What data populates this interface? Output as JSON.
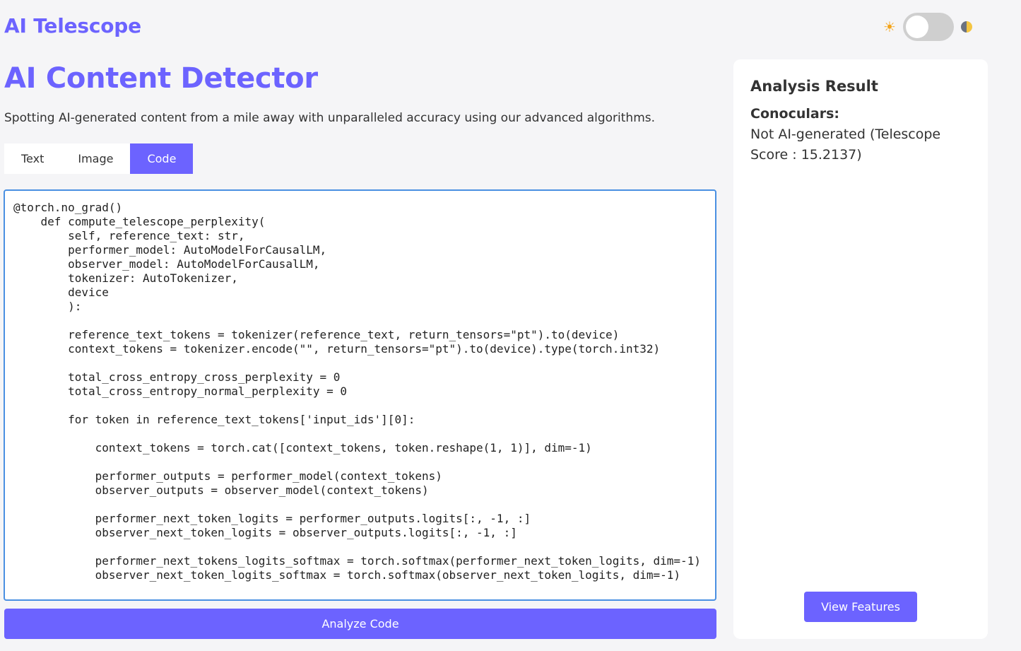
{
  "app": {
    "title": "AI Telescope"
  },
  "theme": {
    "sun_icon": "sun-icon",
    "moon_icon": "moon-icon",
    "sun_glyph": "☀"
  },
  "header": {
    "title": "AI Content Detector",
    "subtitle": "Spotting AI-generated content from a mile away with unparalleled accuracy using our advanced algorithms."
  },
  "tabs": [
    {
      "label": "Text",
      "active": false
    },
    {
      "label": "Image",
      "active": false
    },
    {
      "label": "Code",
      "active": true
    }
  ],
  "editor": {
    "code": "@torch.no_grad()\n    def compute_telescope_perplexity(\n        self, reference_text: str,\n        performer_model: AutoModelForCausalLM,\n        observer_model: AutoModelForCausalLM,\n        tokenizer: AutoTokenizer,\n        device\n        ):\n\n        reference_text_tokens = tokenizer(reference_text, return_tensors=\"pt\").to(device)\n        context_tokens = tokenizer.encode(\"\", return_tensors=\"pt\").to(device).type(torch.int32)\n\n        total_cross_entropy_cross_perplexity = 0\n        total_cross_entropy_normal_perplexity = 0\n\n        for token in reference_text_tokens['input_ids'][0]:\n\n            context_tokens = torch.cat([context_tokens, token.reshape(1, 1)], dim=-1)\n\n            performer_outputs = performer_model(context_tokens)\n            observer_outputs = observer_model(context_tokens)\n\n            performer_next_token_logits = performer_outputs.logits[:, -1, :]\n            observer_next_token_logits = observer_outputs.logits[:, -1, :]\n\n            performer_next_tokens_logits_softmax = torch.softmax(performer_next_token_logits, dim=-1)\n            observer_next_token_logits_softmax = torch.softmax(observer_next_token_logits, dim=-1)"
  },
  "actions": {
    "analyze_label": "Analyze Code"
  },
  "result": {
    "title": "Analysis Result",
    "label": "Conoculars:",
    "text": "Not AI-generated (Telescope Score : 15.2137)",
    "view_features_label": "View Features"
  },
  "colors": {
    "accent": "#6c63ff",
    "editor_border": "#4a90e2"
  }
}
